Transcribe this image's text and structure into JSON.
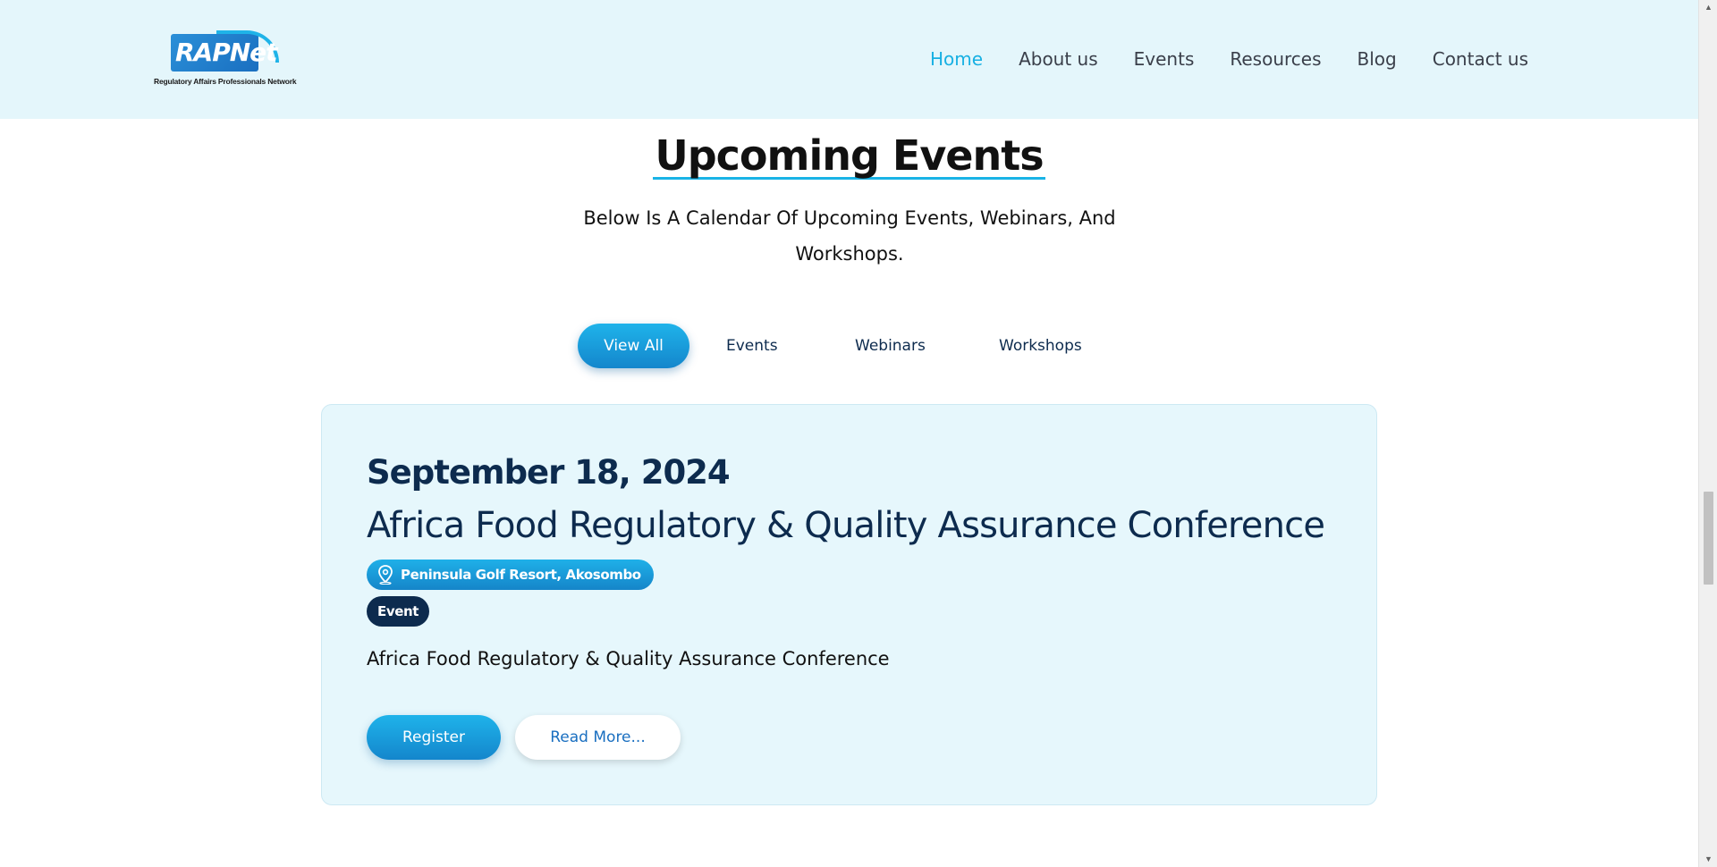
{
  "brand": {
    "logo_text": "RAPNet",
    "tagline": "Regulatory Affairs Professionals Network"
  },
  "nav": {
    "items": [
      {
        "label": "Home",
        "active": true
      },
      {
        "label": "About us",
        "active": false
      },
      {
        "label": "Events",
        "active": false
      },
      {
        "label": "Resources",
        "active": false
      },
      {
        "label": "Blog",
        "active": false
      },
      {
        "label": "Contact us",
        "active": false
      }
    ]
  },
  "section": {
    "title": "Upcoming Events",
    "subtitle": "Below Is A Calendar Of Upcoming Events, Webinars, And Workshops."
  },
  "filters": [
    {
      "label": "View All",
      "active": true
    },
    {
      "label": "Events",
      "active": false
    },
    {
      "label": "Webinars",
      "active": false
    },
    {
      "label": "Workshops",
      "active": false
    }
  ],
  "event": {
    "date": "September 18, 2024",
    "title": "Africa Food Regulatory & Quality Assurance Conference",
    "location": "Peninsula Golf Resort, Akosombo",
    "location_icon": "map-pin-icon",
    "type": "Event",
    "description": "Africa Food Regulatory & Quality Assurance Conference",
    "register_label": "Register",
    "read_more_label": "Read More..."
  },
  "colors": {
    "accent": "#17b0e3",
    "navy": "#0d2b4e",
    "header_bg": "#e4f6fb",
    "card_bg": "#e6f7fc"
  }
}
